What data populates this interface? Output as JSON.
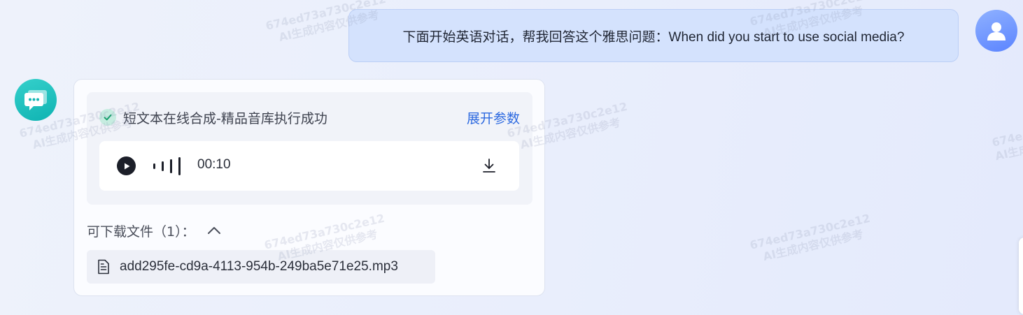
{
  "user_message": {
    "text": "下面开始英语对话，帮我回答这个雅思问题：When did you start to use social media?"
  },
  "bot_message": {
    "status_text": "短文本在线合成-精品音库执行成功",
    "expand_link": "展开参数",
    "audio": {
      "time": "00:10"
    },
    "files_label": "可下载文件（1）：",
    "file_name": "add295fe-cd9a-4113-954b-249ba5e71e25.mp3"
  },
  "watermark": {
    "line1": "674ed73a730c2e12",
    "line2": "AI生成内容仅供参考"
  },
  "colors": {
    "user_bubble": "#d4e2fd",
    "link": "#2e6ae0",
    "bot_avatar": "#1cc1be",
    "user_avatar": "#6b8fff"
  },
  "icons": [
    "user-icon",
    "chat-bubble-icon",
    "check-icon",
    "play-icon",
    "waveform-icon",
    "download-icon",
    "chevron-up-icon",
    "file-icon"
  ]
}
